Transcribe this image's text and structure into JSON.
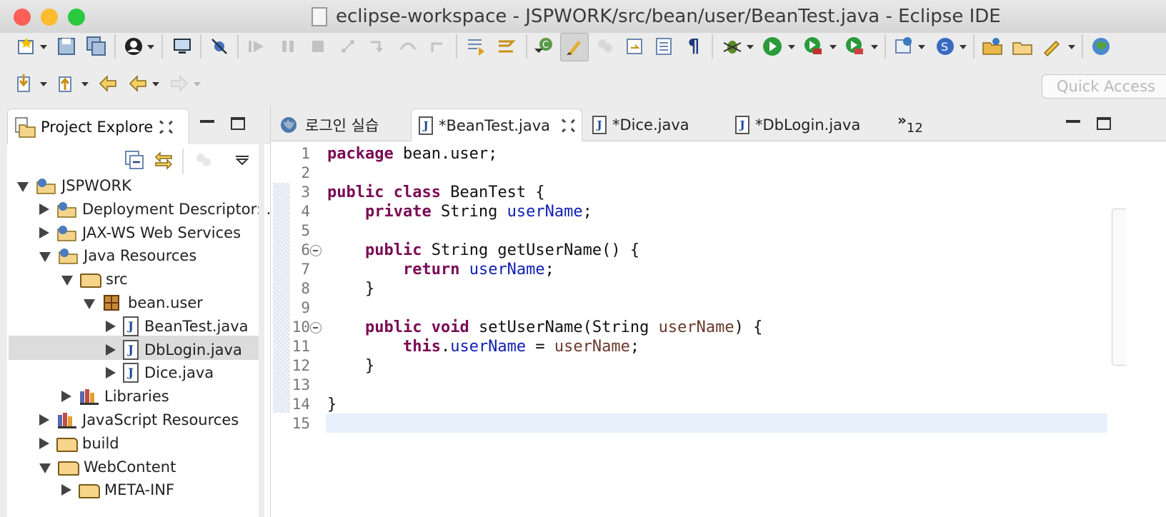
{
  "window": {
    "title": "eclipse-workspace - JSPWORK/src/bean/user/BeanTest.java - Eclipse IDE",
    "traffic_lights": {
      "close": "#fc5f57",
      "minimize": "#fdbc2e",
      "zoom": "#2ac940"
    }
  },
  "toolbar": {
    "row1_icons": [
      "new-wizard-icon",
      "save-icon",
      "save-all-icon",
      "user-icon",
      "monitor-icon",
      "skip-breakpoints-icon",
      "resume-icon",
      "suspend-icon",
      "terminate-icon",
      "disconnect-icon",
      "step-into-icon",
      "step-over-icon",
      "step-return-icon",
      "drop-to-frame-icon",
      "use-step-filters-icon",
      "new-class-icon",
      "mark-occurrences-icon",
      "show-whitespace-icon",
      "toggle-block-icon",
      "task-icon",
      "pilcrow-icon",
      "debug-icon",
      "run-icon",
      "coverage-icon",
      "run-external-icon",
      "new-server-icon",
      "new-service-icon",
      "open-folder-icon",
      "open-project-icon",
      "tool-icon",
      "globe-icon"
    ],
    "row2_icons": [
      "next-annotation-icon",
      "prev-annotation-icon",
      "last-edit-icon",
      "back-icon",
      "forward-icon"
    ],
    "pilcrow": "¶",
    "quick_access_placeholder": "Quick Access"
  },
  "explorer": {
    "title": "Project Explore",
    "tree": [
      {
        "label": "JSPWORK",
        "icon": "project-icon",
        "expanded": true
      },
      {
        "label": "Deployment Descriptor: .",
        "icon": "deployment-descriptor-icon",
        "expanded": false
      },
      {
        "label": "JAX-WS Web Services",
        "icon": "web-services-icon",
        "expanded": false
      },
      {
        "label": "Java Resources",
        "icon": "java-resources-icon",
        "expanded": true
      },
      {
        "label": "src",
        "icon": "source-folder-icon",
        "expanded": true
      },
      {
        "label": "bean.user",
        "icon": "package-icon",
        "expanded": true
      },
      {
        "label": "BeanTest.java",
        "icon": "java-file-icon",
        "expanded": false
      },
      {
        "label": "DbLogin.java",
        "icon": "java-file-icon",
        "expanded": false,
        "selected": true
      },
      {
        "label": "Dice.java",
        "icon": "java-file-icon",
        "expanded": false
      },
      {
        "label": "Libraries",
        "icon": "libraries-icon",
        "expanded": false
      },
      {
        "label": "JavaScript Resources",
        "icon": "javascript-resources-icon",
        "expanded": false
      },
      {
        "label": "build",
        "icon": "folder-icon",
        "expanded": false
      },
      {
        "label": "WebContent",
        "icon": "folder-icon",
        "expanded": true
      },
      {
        "label": "META-INF",
        "icon": "folder-icon",
        "expanded": false
      }
    ]
  },
  "editor": {
    "tabs": [
      {
        "label": "로그인 실습",
        "icon": "globe-icon",
        "active": false
      },
      {
        "label": "*BeanTest.java",
        "icon": "java-file-icon",
        "active": true
      },
      {
        "label": "*Dice.java",
        "icon": "java-file-icon",
        "active": false
      },
      {
        "label": "*DbLogin.java",
        "icon": "java-file-icon",
        "active": false
      }
    ],
    "overflow_marker": "»",
    "overflow_count": "12",
    "java_letter": "J",
    "line_numbers": [
      "1",
      "2",
      "3",
      "4",
      "5",
      "6",
      "7",
      "8",
      "9",
      "10",
      "11",
      "12",
      "13",
      "14",
      "15"
    ],
    "code_lines": [
      "package bean.user;",
      "",
      "public class BeanTest {",
      "    private String userName;",
      "",
      "    public String getUserName() {",
      "        return userName;",
      "    }",
      "",
      "    public void setUserName(String userName) {",
      "        this.userName = userName;",
      "    }",
      "",
      "}",
      ""
    ]
  }
}
